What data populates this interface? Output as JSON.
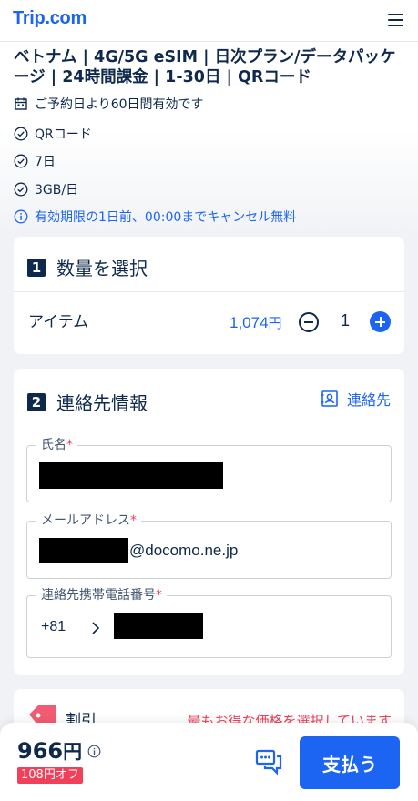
{
  "header": {
    "logo_text": "Trip.com",
    "menu_icon": "hamburger-menu-icon"
  },
  "product": {
    "title": "ベトナム | 4G/5G eSIM | 日次プラン/データパッケージ | 24時間課金 | 1-30日 | QRコード",
    "features": [
      {
        "icon": "calendar-icon",
        "text": "ご予約日より60日間有効です"
      },
      {
        "icon": "check-circle-icon",
        "text": "QRコード"
      },
      {
        "icon": "check-circle-icon",
        "text": "7日"
      },
      {
        "icon": "check-circle-icon",
        "text": "3GB/日"
      }
    ],
    "cancellation": {
      "icon": "info-icon",
      "text": "有効期限の1日前、00:00までキャンセル無料"
    }
  },
  "quantity_section": {
    "step": "1",
    "title": "数量を選択",
    "item_label": "アイテム",
    "price_value": "1,074",
    "price_unit": "円",
    "quantity": "1"
  },
  "contact_section": {
    "step": "2",
    "title": "連絡先情報",
    "contacts_link": "連絡先",
    "name_field": {
      "label": "氏名",
      "required_mark": "*"
    },
    "email_field": {
      "label": "メールアドレス",
      "required_mark": "*",
      "visible_suffix": "@docomo.ne.jp"
    },
    "phone_field": {
      "label": "連絡先携帯電話番号",
      "required_mark": "*",
      "country_code": "+81"
    }
  },
  "discount_section": {
    "label": "割引",
    "note": "最もお得な価格を選択しています"
  },
  "footer": {
    "total_value": "966",
    "total_unit": "円",
    "discount_badge": "108円オフ",
    "pay_button": "支払う"
  },
  "colors": {
    "brand_blue": "#1c64f2",
    "text_navy": "#0f294d",
    "discount_red": "#f0405a"
  }
}
